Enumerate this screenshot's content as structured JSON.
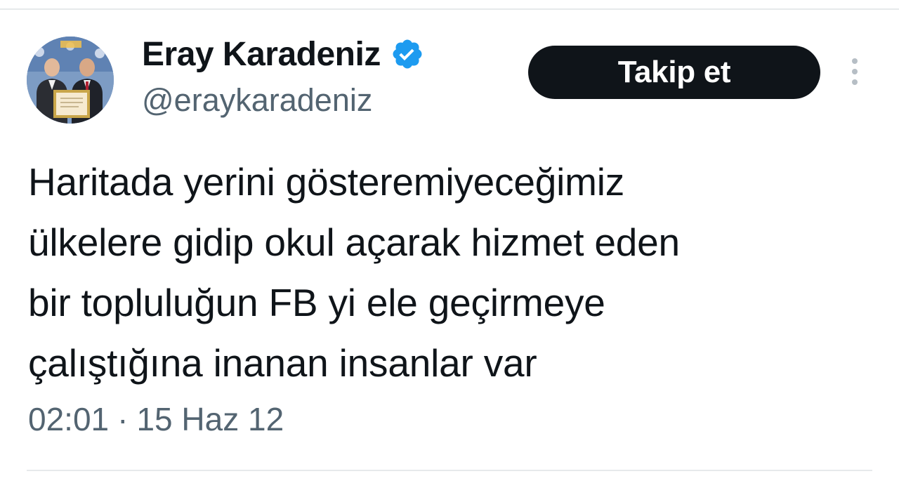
{
  "user": {
    "display_name": "Eray Karadeniz",
    "handle": "@eraykaradeniz",
    "verified_icon": "verified-badge-icon",
    "avatar_icon": "profile-photo"
  },
  "actions": {
    "follow_label": "Takip et",
    "more_icon": "more-options-icon"
  },
  "tweet": {
    "text": "Haritada yerini gösteremiyeceğimiz\nülkelere gidip okul açarak hizmet eden\nbir topluluğun FB yi ele geçirmeye\nçalıştığına inanan insanlar var",
    "time": "02:01",
    "separator": "·",
    "date": "15 Haz 12"
  },
  "colors": {
    "text_primary": "#0f1419",
    "text_secondary": "#536471",
    "verified_blue": "#1d9bf0",
    "button_bg": "#0f1419",
    "divider": "#e6e9eb"
  }
}
